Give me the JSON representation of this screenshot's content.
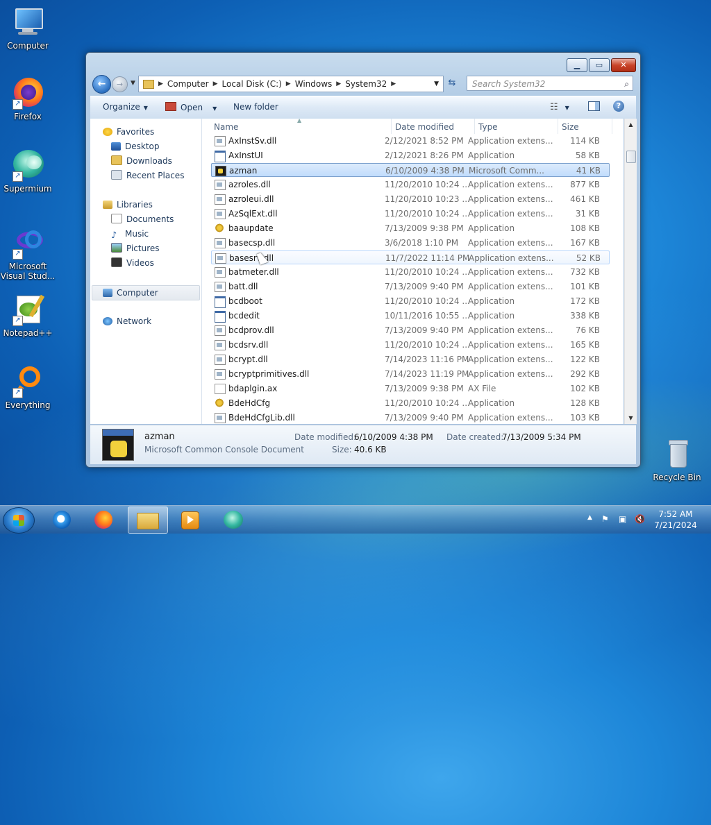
{
  "desktop": {
    "icons": [
      {
        "label": "Computer"
      },
      {
        "label": "Firefox"
      },
      {
        "label": "Supermium"
      },
      {
        "label": "Microsoft Visual Stud..."
      },
      {
        "label": "Notepad++"
      },
      {
        "label": "Everything"
      },
      {
        "label": "Recycle Bin"
      }
    ]
  },
  "window": {
    "address": {
      "segments": [
        "Computer",
        "Local Disk (C:)",
        "Windows",
        "System32"
      ]
    },
    "search_placeholder": "Search System32",
    "toolbar": {
      "organize": "Organize",
      "open": "Open",
      "new_folder": "New folder"
    },
    "nav": {
      "favorites": "Favorites",
      "desktop": "Desktop",
      "downloads": "Downloads",
      "recent_places": "Recent Places",
      "libraries": "Libraries",
      "documents": "Documents",
      "music": "Music",
      "pictures": "Pictures",
      "videos": "Videos",
      "computer": "Computer",
      "network": "Network"
    },
    "columns": {
      "name": "Name",
      "date_modified": "Date modified",
      "type": "Type",
      "size": "Size"
    },
    "files": [
      {
        "name": "AxInstSv.dll",
        "date": "2/12/2021 8:52 PM",
        "type": "Application extens...",
        "size": "114 KB",
        "icon": "dll"
      },
      {
        "name": "AxInstUI",
        "date": "2/12/2021 8:26 PM",
        "type": "Application",
        "size": "58 KB",
        "icon": "app"
      },
      {
        "name": "azman",
        "date": "6/10/2009 4:38 PM",
        "type": "Microsoft Comm...",
        "size": "41 KB",
        "icon": "msc"
      },
      {
        "name": "azroles.dll",
        "date": "11/20/2010 10:24 ...",
        "type": "Application extens...",
        "size": "877 KB",
        "icon": "dll"
      },
      {
        "name": "azroleui.dll",
        "date": "11/20/2010 10:23 ...",
        "type": "Application extens...",
        "size": "461 KB",
        "icon": "dll"
      },
      {
        "name": "AzSqlExt.dll",
        "date": "11/20/2010 10:24 ...",
        "type": "Application extens...",
        "size": "31 KB",
        "icon": "dll"
      },
      {
        "name": "baaupdate",
        "date": "7/13/2009 9:38 PM",
        "type": "Application",
        "size": "108 KB",
        "icon": "gear"
      },
      {
        "name": "basecsp.dll",
        "date": "3/6/2018 1:10 PM",
        "type": "Application extens...",
        "size": "167 KB",
        "icon": "dll"
      },
      {
        "name": "basesrv.dll",
        "date": "11/7/2022 11:14 PM",
        "type": "Application extens...",
        "size": "52 KB",
        "icon": "dll"
      },
      {
        "name": "batmeter.dll",
        "date": "11/20/2010 10:24 ...",
        "type": "Application extens...",
        "size": "732 KB",
        "icon": "dll"
      },
      {
        "name": "batt.dll",
        "date": "7/13/2009 9:40 PM",
        "type": "Application extens...",
        "size": "101 KB",
        "icon": "dll"
      },
      {
        "name": "bcdboot",
        "date": "11/20/2010 10:24 ...",
        "type": "Application",
        "size": "172 KB",
        "icon": "app"
      },
      {
        "name": "bcdedit",
        "date": "10/11/2016 10:55 ...",
        "type": "Application",
        "size": "338 KB",
        "icon": "app"
      },
      {
        "name": "bcdprov.dll",
        "date": "7/13/2009 9:40 PM",
        "type": "Application extens...",
        "size": "76 KB",
        "icon": "dll"
      },
      {
        "name": "bcdsrv.dll",
        "date": "11/20/2010 10:24 ...",
        "type": "Application extens...",
        "size": "165 KB",
        "icon": "dll"
      },
      {
        "name": "bcrypt.dll",
        "date": "7/14/2023 11:16 PM",
        "type": "Application extens...",
        "size": "122 KB",
        "icon": "dll"
      },
      {
        "name": "bcryptprimitives.dll",
        "date": "7/14/2023 11:19 PM",
        "type": "Application extens...",
        "size": "292 KB",
        "icon": "dll"
      },
      {
        "name": "bdaplgin.ax",
        "date": "7/13/2009 9:38 PM",
        "type": "AX File",
        "size": "102 KB",
        "icon": "ax"
      },
      {
        "name": "BdeHdCfg",
        "date": "11/20/2010 10:24 ...",
        "type": "Application",
        "size": "128 KB",
        "icon": "gear"
      },
      {
        "name": "BdeHdCfgLib.dll",
        "date": "7/13/2009 9:40 PM",
        "type": "Application extens...",
        "size": "103 KB",
        "icon": "dll"
      }
    ],
    "selected_index": 2,
    "hover_index": 8,
    "details": {
      "name": "azman",
      "type": "Microsoft Common Console Document",
      "date_modified_label": "Date modified:",
      "date_modified": "6/10/2009 4:38 PM",
      "date_created_label": "Date created:",
      "date_created": "7/13/2009 5:34 PM",
      "size_label": "Size:",
      "size": "40.6 KB"
    }
  },
  "taskbar": {
    "time": "7:52 AM",
    "date": "7/21/2024"
  }
}
